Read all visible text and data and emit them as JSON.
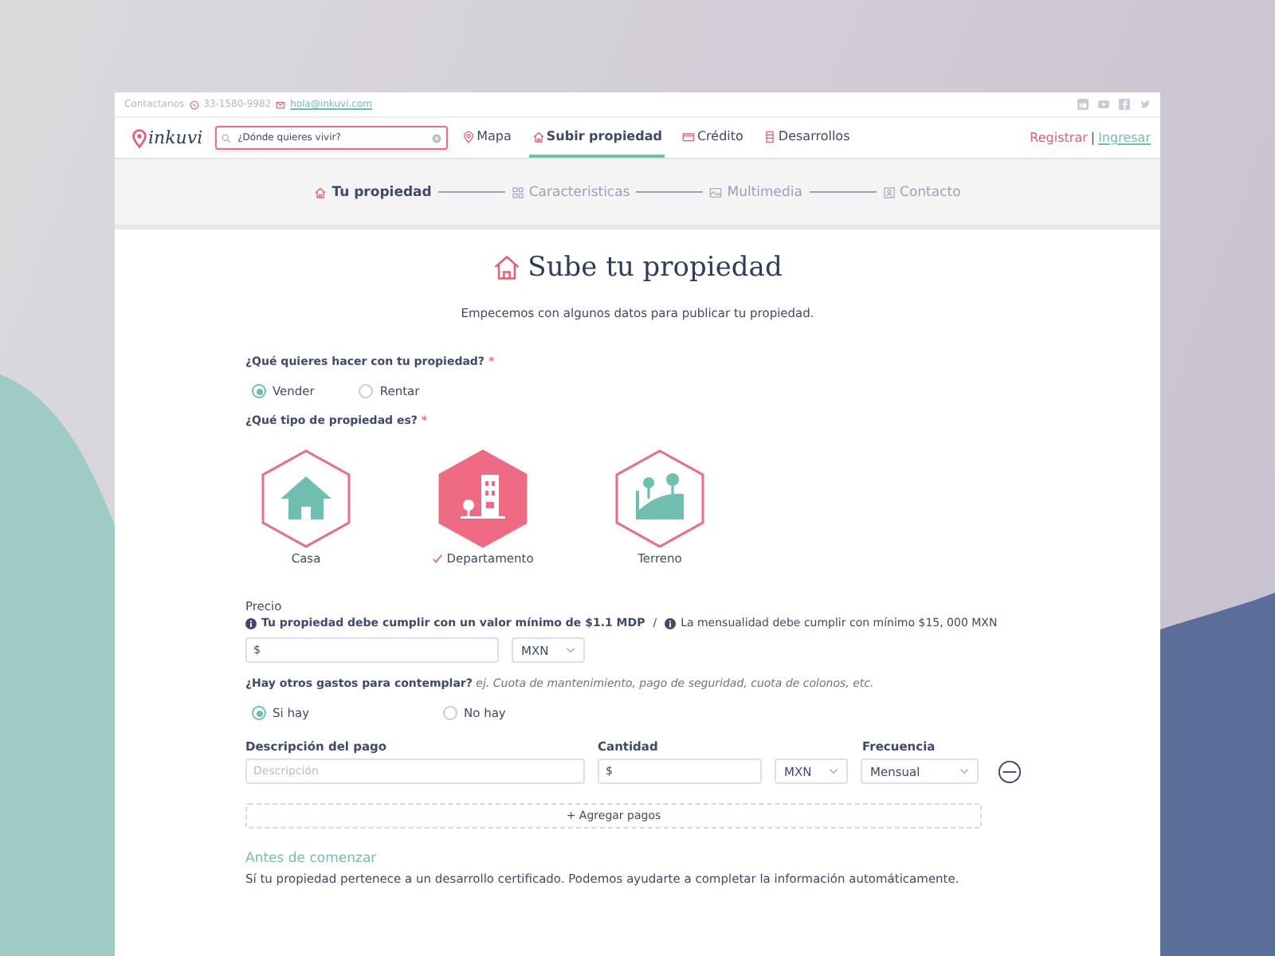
{
  "contact": {
    "label": "Contactanos",
    "phone": "33-1580-9982",
    "email": "hola@inkuvi.com"
  },
  "logo": "inkuvi",
  "search": {
    "placeholder": "¿Dónde quieres vivir?"
  },
  "nav": [
    {
      "label": "Mapa",
      "selected": false
    },
    {
      "label": "Subir propiedad",
      "selected": true
    },
    {
      "label": "Crédito",
      "selected": false
    },
    {
      "label": "Desarrollos",
      "selected": false
    }
  ],
  "auth": {
    "register": "Registrar",
    "separator": "|",
    "login": "Ingresar"
  },
  "steps": [
    {
      "label": "Tu propiedad",
      "selected": true
    },
    {
      "label": "Caracteristicas",
      "selected": false
    },
    {
      "label": "Multimedia",
      "selected": false
    },
    {
      "label": "Contacto",
      "selected": false
    }
  ],
  "title": "Sube tu propiedad",
  "subtitle": "Empecemos con algunos datos para publicar tu propiedad.",
  "operation": {
    "label": "¿Qué quieres hacer con tu propiedad?",
    "required_mark": "*",
    "options": [
      {
        "label": "Vender",
        "selected": true
      },
      {
        "label": "Rentar",
        "selected": false
      }
    ]
  },
  "property_type": {
    "label": "¿Qué tipo de propiedad es?",
    "required_mark": "*",
    "options": [
      {
        "label": "Casa",
        "kind": "house",
        "selected": false
      },
      {
        "label": "Departamento",
        "kind": "building",
        "selected": true
      },
      {
        "label": "Terreno",
        "kind": "land",
        "selected": false
      }
    ]
  },
  "price": {
    "label": "Precio",
    "notes": [
      {
        "text": "Tu propiedad debe cumplir con un valor mínimo de $1.1 MDP",
        "bold": true
      },
      {
        "text": "La mensualidad debe cumplir con mínimo $15, 000 MXN",
        "bold": false
      }
    ],
    "separator": "/",
    "value": "$",
    "currency": "MXN"
  },
  "expenses": {
    "question": "¿Hay otros gastos para contemplar?",
    "hint": "ej.  Cuota de mantenimiento, pago de seguridad, cuota de colonos, etc.",
    "options": [
      {
        "label": "Si hay",
        "selected": true
      },
      {
        "label": "No hay",
        "selected": false
      }
    ]
  },
  "payments": {
    "columns": [
      "Descripción del pago",
      "Cantidad",
      "Frecuencia"
    ],
    "rows": [
      {
        "description_placeholder": "Descripción",
        "amount": "$",
        "currency": "MXN",
        "frequency": "Mensual"
      }
    ],
    "add_button": "+ Agregar pagos"
  },
  "notice": {
    "title": "Antes de comenzar",
    "text": "Sí tu propiedad pertenece a un desarrollo certificado. Podemos ayudarte a completar la información automáticamente."
  }
}
